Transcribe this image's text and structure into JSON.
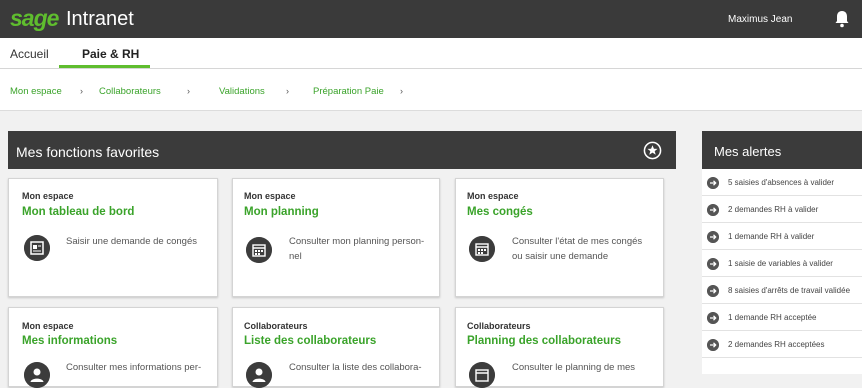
{
  "header": {
    "logo": "sage",
    "title": "Intranet",
    "user": "Maximus Jean",
    "bell_icon": "bell-icon"
  },
  "tabs": [
    {
      "label": "Accueil"
    },
    {
      "label": "Paie & RH",
      "active": true
    }
  ],
  "breadcrumb": [
    "Mon espace",
    "Collaborateurs",
    "Validations",
    "Préparation Paie"
  ],
  "favorites": {
    "title": "Mes fonctions favorites",
    "cards": [
      {
        "category": "Mon espace",
        "title": "Mon tableau de bord",
        "desc1": "Saisir une demande de congés",
        "desc2": "",
        "icon": "form-icon"
      },
      {
        "category": "Mon espace",
        "title": "Mon planning",
        "desc1": "Consulter mon planning person-",
        "desc2": "nel",
        "icon": "calendar-icon"
      },
      {
        "category": "Mon espace",
        "title": "Mes congés",
        "desc1": "Consulter l'état de mes congés",
        "desc2": "ou saisir une demande",
        "icon": "calendar-icon"
      },
      {
        "category": "Mon espace",
        "title": "Mes informations",
        "desc1": "Consulter mes informations per-",
        "desc2": "",
        "icon": "user-icon"
      },
      {
        "category": "Collaborateurs",
        "title": "Liste des collaborateurs",
        "desc1": "Consulter la liste des collabora-",
        "desc2": "",
        "icon": "users-icon"
      },
      {
        "category": "Collaborateurs",
        "title": "Planning des collaborateurs",
        "desc1": "Consulter le planning de mes",
        "desc2": "",
        "icon": "calendar-icon"
      }
    ]
  },
  "alerts": {
    "title": "Mes alertes",
    "items": [
      "5 saisies d'absences à valider",
      "2 demandes RH à valider",
      "1 demande RH à valider",
      "1 saisie de variables à valider",
      "8 saisies d'arrêts de travail validée",
      "1 demande RH acceptée",
      "2 demandes RH acceptées"
    ]
  },
  "colors": {
    "accent": "#3aa32a",
    "header": "#3a3a3a"
  }
}
